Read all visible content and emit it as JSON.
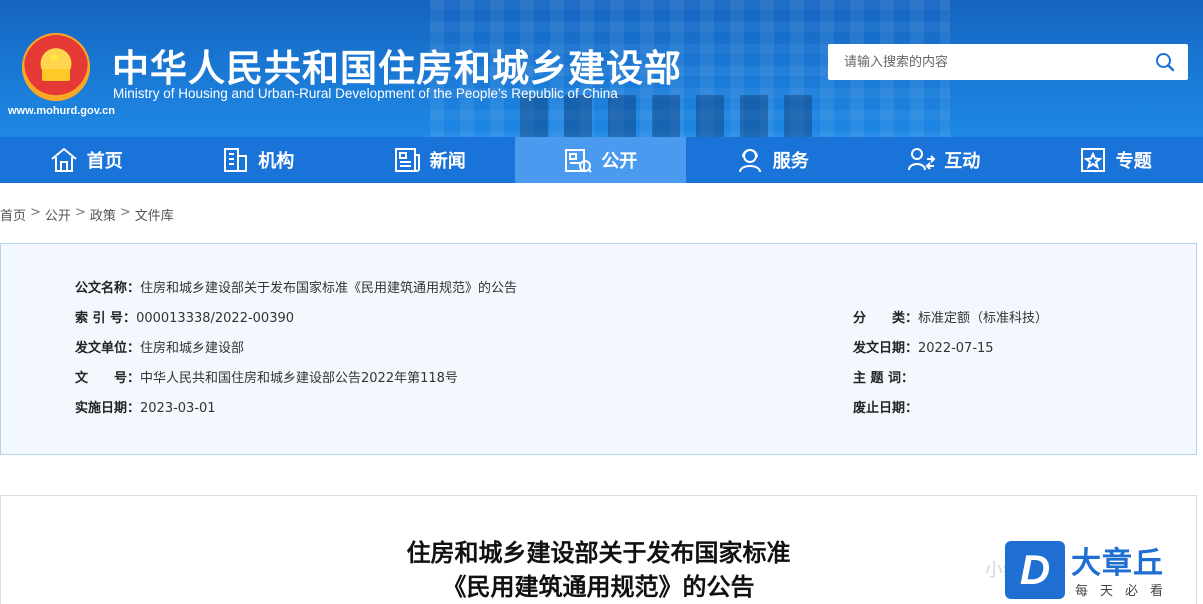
{
  "header": {
    "site_url": "www.mohurd.gov.cn",
    "title": "中华人民共和国住房和城乡建设部",
    "subtitle": "Ministry of Housing and Urban-Rural Development of the People’s Republic of China",
    "search_placeholder": "请输入搜索的内容",
    "brand_color": "#1a73d9"
  },
  "nav": {
    "items": [
      {
        "label": "首页",
        "icon": "home-icon"
      },
      {
        "label": "机构",
        "icon": "building-icon"
      },
      {
        "label": "新闻",
        "icon": "newspaper-icon"
      },
      {
        "label": "公开",
        "icon": "disclosure-icon"
      },
      {
        "label": "服务",
        "icon": "service-icon"
      },
      {
        "label": "互动",
        "icon": "interaction-icon"
      },
      {
        "label": "专题",
        "icon": "star-icon"
      }
    ],
    "active": "公开"
  },
  "breadcrumb": {
    "items": [
      "首页",
      "公开",
      "政策",
      "文件库"
    ],
    "separator": ">"
  },
  "info": {
    "doc_name_label": "公文名称：",
    "doc_name": "住房和城乡建设部关于发布国家标准《民用建筑通用规范》的公告",
    "index_label": "索 引 号：",
    "index": "000013338/2022-00390",
    "category_label": "分　　类：",
    "category": "标准定额（标准科技）",
    "issuer_label": "发文单位：",
    "issuer": "住房和城乡建设部",
    "issue_date_label": "发文日期：",
    "issue_date": "2022-07-15",
    "doc_no_label": "文　　号：",
    "doc_no": "中华人民共和国住房和城乡建设部公告2022年第118号",
    "keywords_label": "主 题 词：",
    "keywords": "",
    "effective_label": "实施日期：",
    "effective": "2023-03-01",
    "repeal_label": "废止日期：",
    "repeal": ""
  },
  "document": {
    "title_line1": "住房和城乡建设部关于发布国家标准",
    "title_line2": "《民用建筑通用规范》的公告"
  },
  "watermark": {
    "badge": "D",
    "name": "大章丘",
    "slogan": "每天必看",
    "faint": "小编"
  }
}
